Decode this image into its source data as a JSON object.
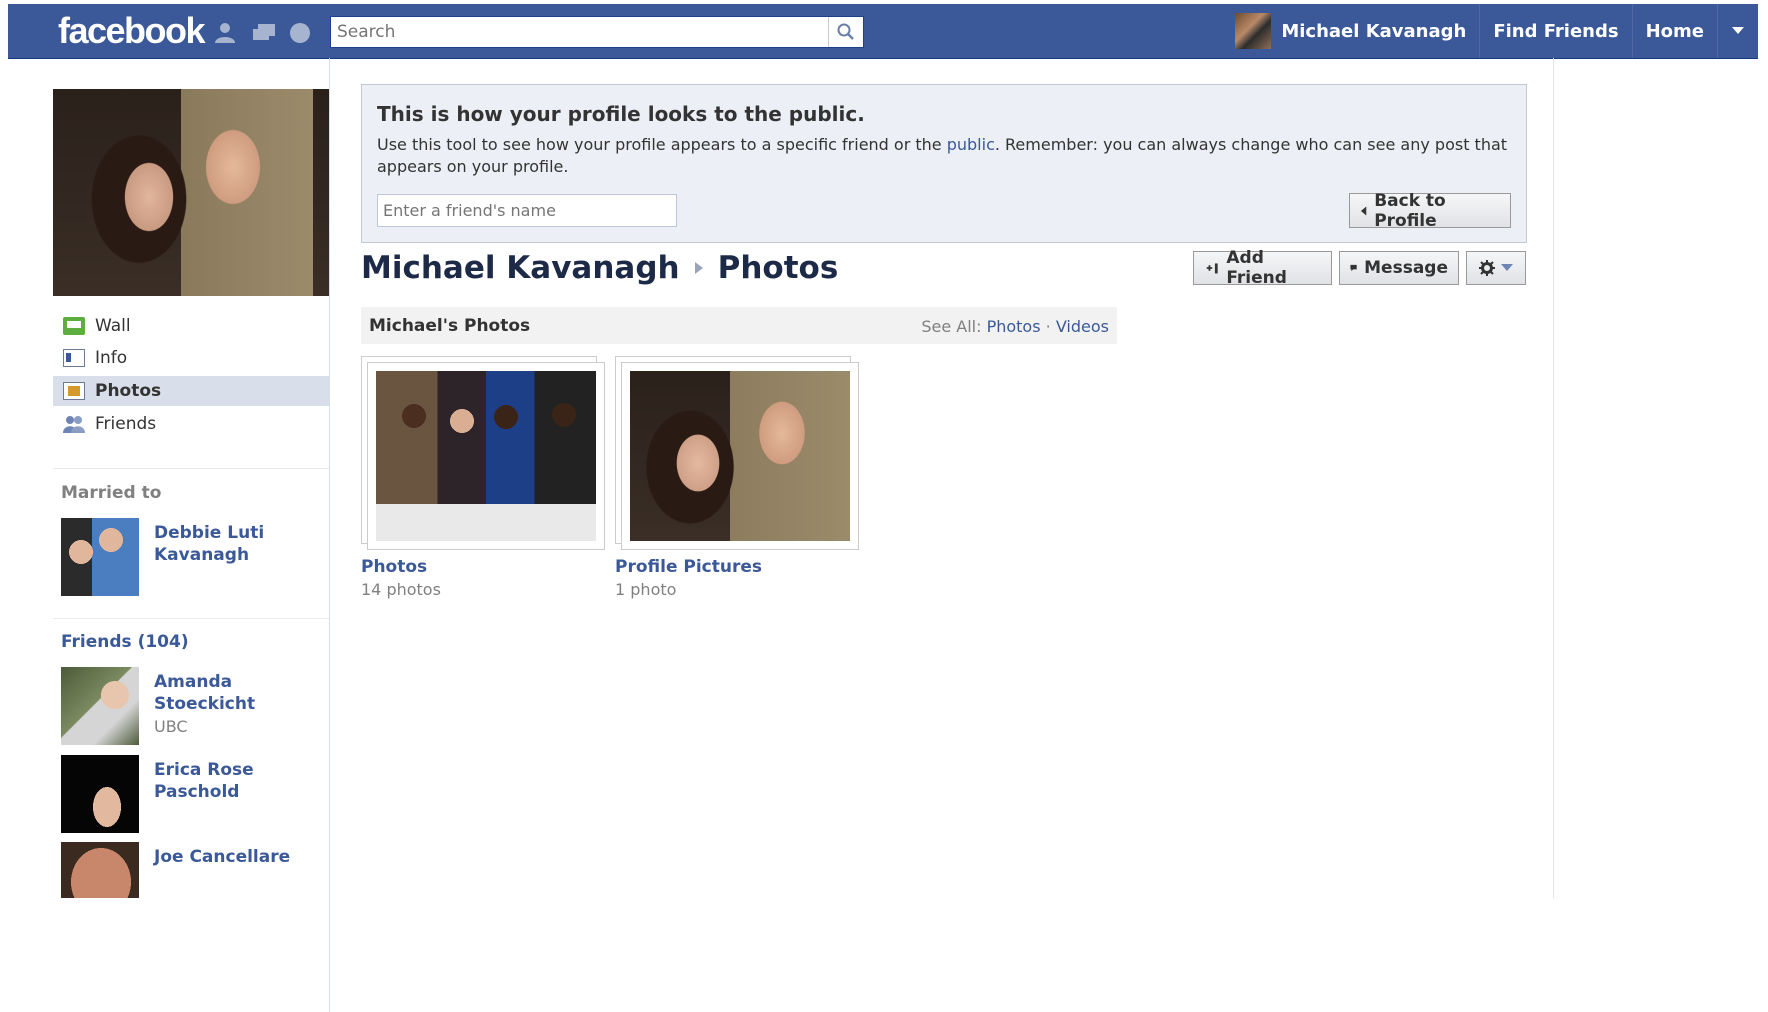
{
  "topbar": {
    "logo": "facebook",
    "search_placeholder": "Search",
    "user_name": "Michael Kavanagh",
    "find_friends": "Find Friends",
    "home": "Home"
  },
  "left": {
    "nav": [
      {
        "label": "Wall"
      },
      {
        "label": "Info"
      },
      {
        "label": "Photos"
      },
      {
        "label": "Friends"
      }
    ],
    "married_header": "Married to",
    "spouse": {
      "name": "Debbie Luti Kavanagh"
    },
    "friends_header": "Friends (104)",
    "friends": [
      {
        "name": "Amanda Stoeckicht",
        "sub": "UBC"
      },
      {
        "name": "Erica Rose Paschold",
        "sub": ""
      },
      {
        "name": "Joe Cancellare",
        "sub": ""
      }
    ]
  },
  "public_box": {
    "title": "This is how your profile looks to the public.",
    "desc_before": "Use this tool to see how your profile appears to a specific friend or the ",
    "desc_link": "public",
    "desc_after": ". Remember: you can always change who can see any post that appears on your profile.",
    "friend_placeholder": "Enter a friend's name",
    "back_button": "Back to Profile"
  },
  "page": {
    "name": "Michael Kavanagh",
    "section": "Photos",
    "add_friend": "Add Friend",
    "message": "Message"
  },
  "photos": {
    "header": "Michael's Photos",
    "see_all_label": "See All:",
    "see_all_photos": "Photos",
    "see_all_sep": "·",
    "see_all_videos": "Videos",
    "albums": [
      {
        "title": "Photos",
        "count": "14 photos"
      },
      {
        "title": "Profile Pictures",
        "count": "1 photo"
      }
    ]
  },
  "colors": {
    "brand_blue": "#3b5998",
    "nav_active": "#d8dfea",
    "link": "#3b5998"
  }
}
